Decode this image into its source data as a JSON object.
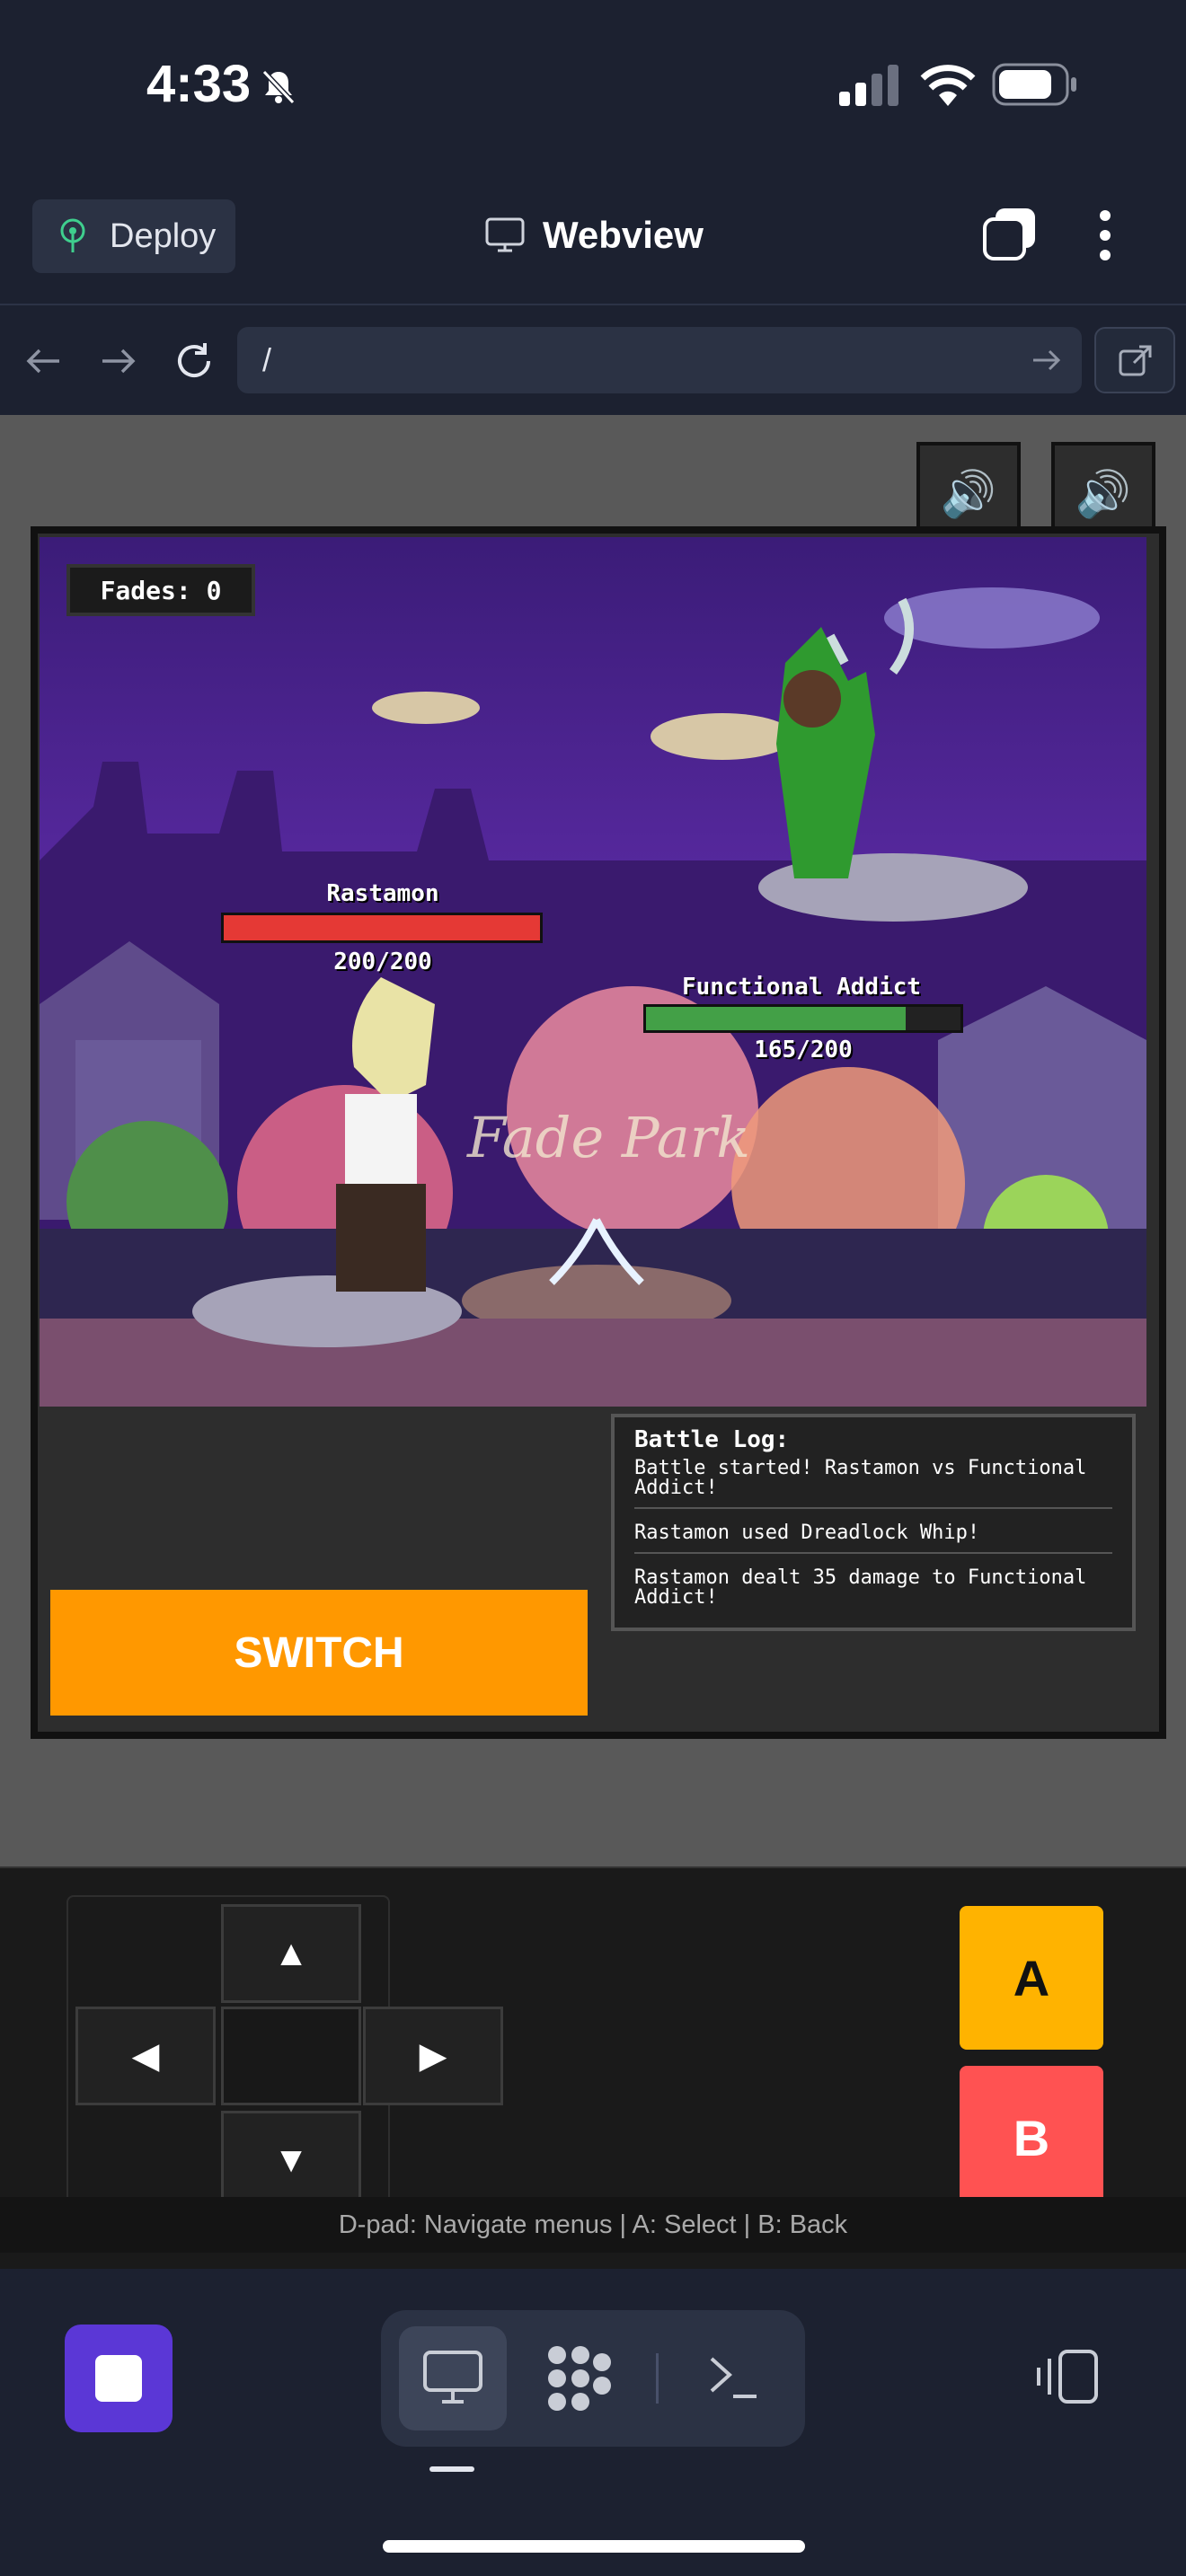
{
  "status": {
    "time": "4:33"
  },
  "toolbar": {
    "deploy_label": "Deploy",
    "title": "Webview"
  },
  "nav": {
    "url": "/"
  },
  "game": {
    "fades_label": "Fades: 0",
    "background_sign": "Fade Park",
    "player": {
      "name": "Rastamon",
      "hp_text": "200/200",
      "hp_fraction": 1.0,
      "hp_color": "#e53935"
    },
    "enemy": {
      "name": "Functional Addict",
      "hp_text": "165/200",
      "hp_fraction": 0.825,
      "hp_color": "#43a047"
    },
    "battle_log": {
      "title": "Battle Log:",
      "entries": [
        "Battle started! Rastamon vs Functional Addict!",
        "Rastamon used Dreadlock Whip!",
        "Rastamon dealt 35 damage to Functional Addict!"
      ]
    },
    "switch_label": "SWITCH",
    "sound_icon_1": "speaker-icon",
    "sound_icon_2": "speaker-icon"
  },
  "controls": {
    "up": "▲",
    "down": "▼",
    "left": "◀",
    "right": "▶",
    "a_label": "A",
    "b_label": "B",
    "hint": "D-pad: Navigate menus | A: Select | B: Back"
  },
  "colors": {
    "switch": "#ff9800",
    "a_button": "#ffb300",
    "b_button": "#ff5252",
    "stop_button": "#5b37d6"
  }
}
